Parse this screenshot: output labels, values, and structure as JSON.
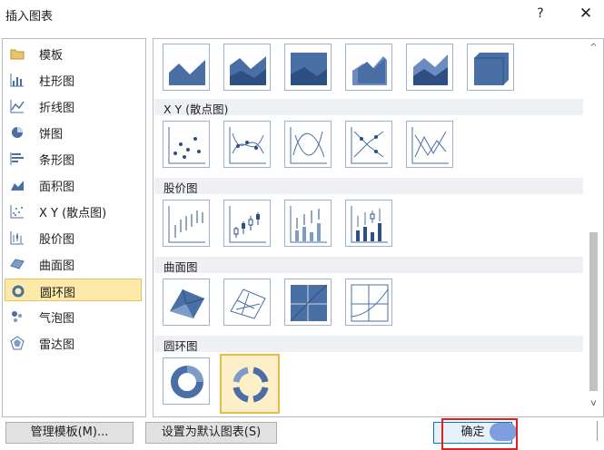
{
  "window": {
    "title": "插入图表",
    "help": "?",
    "close": "✕"
  },
  "categories": [
    {
      "label": "模板",
      "icon": "folder-icon"
    },
    {
      "label": "柱形图",
      "icon": "column-chart-icon"
    },
    {
      "label": "折线图",
      "icon": "line-chart-icon"
    },
    {
      "label": "饼图",
      "icon": "pie-chart-icon"
    },
    {
      "label": "条形图",
      "icon": "bar-chart-icon"
    },
    {
      "label": "面积图",
      "icon": "area-chart-icon"
    },
    {
      "label": "X Y (散点图)",
      "icon": "scatter-chart-icon"
    },
    {
      "label": "股价图",
      "icon": "stock-chart-icon"
    },
    {
      "label": "曲面图",
      "icon": "surface-chart-icon"
    },
    {
      "label": "圆环图",
      "icon": "doughnut-chart-icon",
      "selected": true
    },
    {
      "label": "气泡图",
      "icon": "bubble-chart-icon"
    },
    {
      "label": "雷达图",
      "icon": "radar-chart-icon"
    }
  ],
  "sections": {
    "scatter": "X Y (散点图)",
    "stock": "股价图",
    "surface": "曲面图",
    "doughnut": "圆环图"
  },
  "buttons": {
    "manage": "管理模板(M)...",
    "set_default": "设置为默认图表(S)",
    "ok": "确定"
  },
  "scrollbar": {
    "up": "^",
    "down": "v"
  },
  "colors": {
    "accent": "#0078d7",
    "selected_bg": "#fde9a8",
    "highlight": "#e02020"
  }
}
